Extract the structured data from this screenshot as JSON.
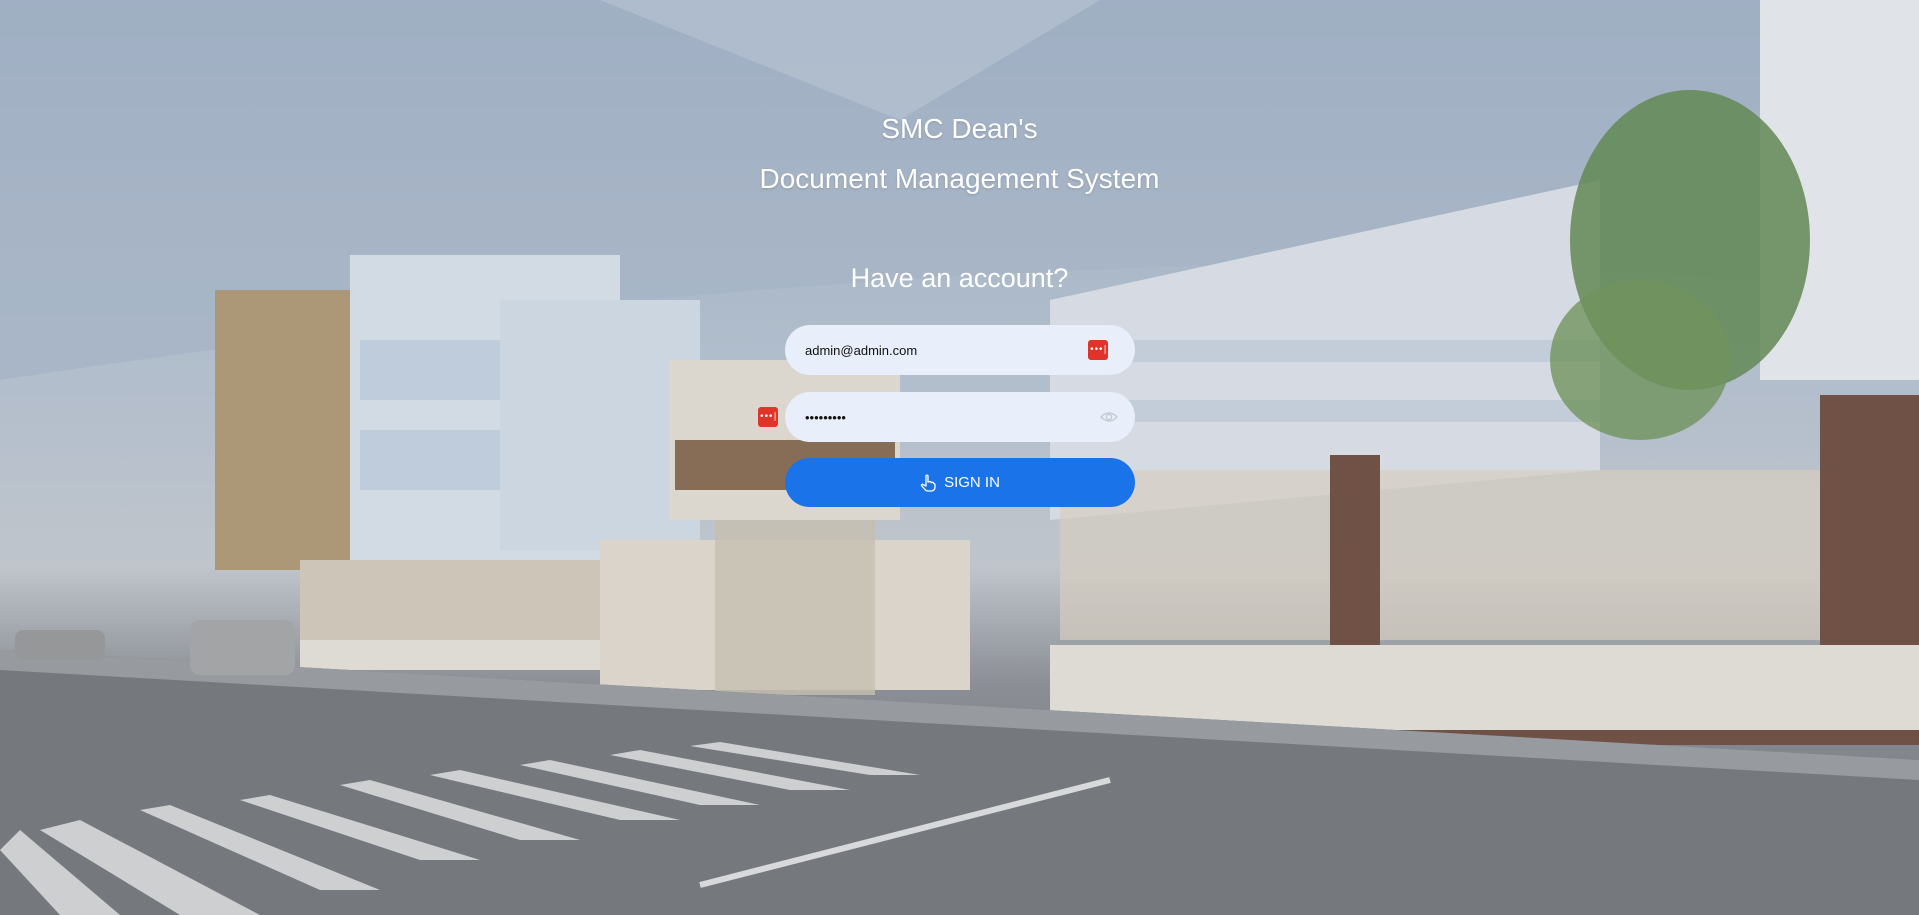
{
  "header": {
    "line1": "SMC Dean's",
    "line2": "Document Management System"
  },
  "login": {
    "prompt": "Have an account?",
    "email_value": "admin@admin.com",
    "password_value": "•••••••••",
    "signin_label": "SIGN IN"
  },
  "icons": {
    "password_manager": "password-manager-icon",
    "show_password": "eye-icon",
    "signin": "hand-pointer-icon"
  },
  "colors": {
    "button": "#1a73e8",
    "field_bg": "#e8effa",
    "pm_icon": "#e0342b"
  }
}
